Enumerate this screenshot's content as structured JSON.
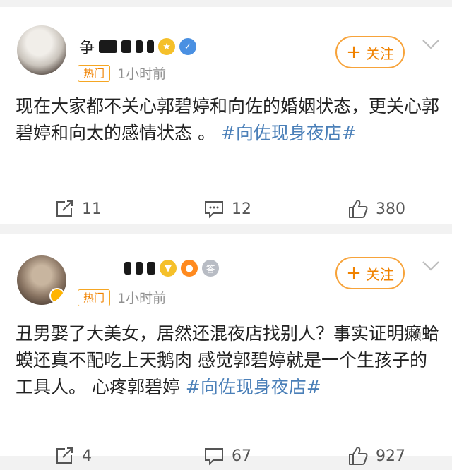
{
  "posts": [
    {
      "username": "争",
      "badge": "热门",
      "time": "1小时前",
      "follow_label": "关注",
      "text": "现在大家都不关心郭碧婷和向佐的婚姻状态，更关心郭碧婷和向太的感情状态 。",
      "hashtag": "#向佐现身夜店#",
      "reposts": "11",
      "comments": "12",
      "likes": "380"
    },
    {
      "username": "",
      "badge": "热门",
      "time": "1小时前",
      "follow_label": "关注",
      "text": "丑男娶了大美女，居然还混夜店找别人？事实证明癞蛤蟆还真不配吃上天鹅肉 感觉郭碧婷就是一个生孩子的工具人。 心疼郭碧婷 ",
      "hashtag": "#向佐现身夜店#",
      "reposts": "4",
      "comments": "67",
      "likes": "927"
    }
  ],
  "colors": {
    "accent": "#f08200",
    "hashtag": "#4a7fb8",
    "background": "#f2f2f2"
  },
  "icons": [
    "repost-icon",
    "comment-icon",
    "like-icon",
    "chevron-down-icon"
  ]
}
